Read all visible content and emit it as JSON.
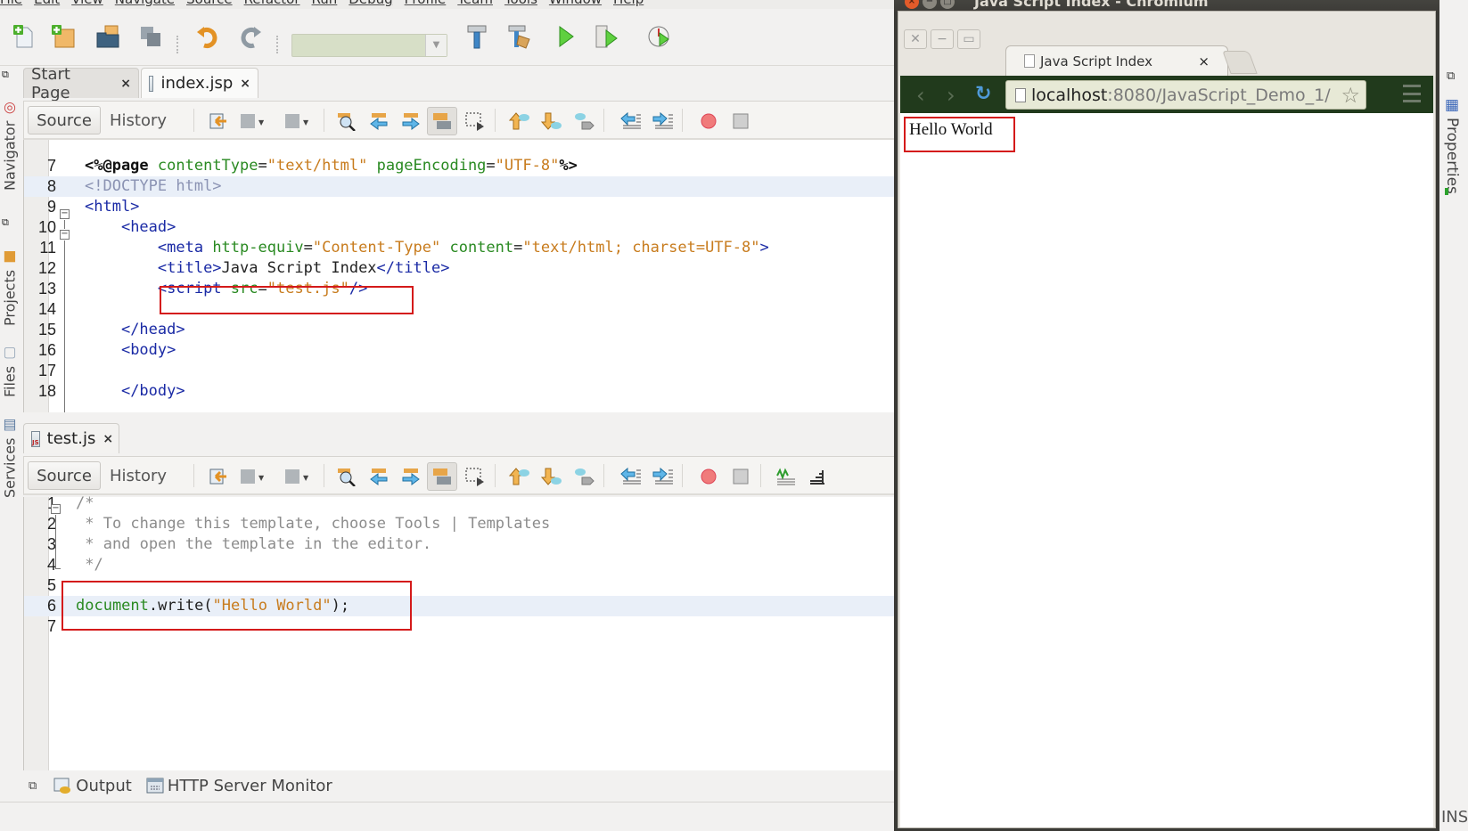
{
  "ide": {
    "menu": [
      "File",
      "Edit",
      "View",
      "Navigate",
      "Source",
      "Refactor",
      "Run",
      "Debug",
      "Profile",
      "Team",
      "Tools",
      "Window",
      "Help"
    ],
    "toolbar": {
      "icons": [
        "new-file-icon",
        "new-project-icon",
        "open-project-icon",
        "save-all-icon",
        "undo-icon",
        "redo-icon",
        "build-icon",
        "clean-build-icon",
        "run-icon",
        "debug-icon",
        "profile-icon"
      ],
      "config_combo_value": ""
    },
    "left_sidebar": [
      "Navigator",
      "Projects",
      "Files",
      "Services"
    ],
    "right_sidebar": [
      "Properties"
    ],
    "top_editor": {
      "tabs": [
        {
          "label": "Start Page",
          "active": false
        },
        {
          "label": "index.jsp",
          "active": true
        }
      ],
      "source_label": "Source",
      "history_label": "History",
      "lines": [
        {
          "n": "7",
          "segments": [
            [
              "dir",
              "<%@page"
            ],
            [
              "plain",
              " "
            ],
            [
              "attr",
              "contentType"
            ],
            [
              "plain",
              "="
            ],
            [
              "str",
              "\"text/html\""
            ],
            [
              "plain",
              " "
            ],
            [
              "attr",
              "pageEncoding"
            ],
            [
              "plain",
              "="
            ],
            [
              "str",
              "\"UTF-8\""
            ],
            [
              "dir",
              "%>"
            ]
          ]
        },
        {
          "n": "8",
          "segments": [
            [
              "doct",
              "<!DOCTYPE html>"
            ]
          ],
          "highlight": true
        },
        {
          "n": "9",
          "segments": [
            [
              "tag",
              "<html>"
            ]
          ]
        },
        {
          "n": "10",
          "segments": [
            [
              "plain",
              "    "
            ],
            [
              "tag",
              "<head>"
            ]
          ]
        },
        {
          "n": "11",
          "segments": [
            [
              "plain",
              "        "
            ],
            [
              "tag",
              "<meta "
            ],
            [
              "attr",
              "http-equiv"
            ],
            [
              "plain",
              "="
            ],
            [
              "str",
              "\"Content-Type\""
            ],
            [
              "plain",
              " "
            ],
            [
              "attr",
              "content"
            ],
            [
              "plain",
              "="
            ],
            [
              "str",
              "\"text/html; charset=UTF-8\""
            ],
            [
              "tag",
              ">"
            ]
          ]
        },
        {
          "n": "12",
          "segments": [
            [
              "plain",
              "        "
            ],
            [
              "tag",
              "<title>"
            ],
            [
              "plain",
              "Java Script Index"
            ],
            [
              "tag",
              "</title>"
            ]
          ]
        },
        {
          "n": "13",
          "segments": [
            [
              "plain",
              "        "
            ],
            [
              "tag",
              "<script "
            ],
            [
              "attr",
              "src"
            ],
            [
              "plain",
              "="
            ],
            [
              "str",
              "\"test.js\""
            ],
            [
              "tag",
              "/>"
            ]
          ]
        },
        {
          "n": "14",
          "segments": []
        },
        {
          "n": "15",
          "segments": [
            [
              "plain",
              "    "
            ],
            [
              "tag",
              "</head>"
            ]
          ]
        },
        {
          "n": "16",
          "segments": [
            [
              "plain",
              "    "
            ],
            [
              "tag",
              "<body>"
            ]
          ]
        },
        {
          "n": "17",
          "segments": []
        },
        {
          "n": "18",
          "segments": [
            [
              "plain",
              "    "
            ],
            [
              "tag",
              "</body>"
            ]
          ]
        }
      ]
    },
    "bottom_editor": {
      "tabs": [
        {
          "label": "test.js",
          "active": true
        }
      ],
      "source_label": "Source",
      "history_label": "History",
      "lines": [
        {
          "n": "1",
          "segments": [
            [
              "cmt",
              "/*"
            ]
          ]
        },
        {
          "n": "2",
          "segments": [
            [
              "cmt",
              " * To change this template, choose Tools | Templates"
            ]
          ]
        },
        {
          "n": "3",
          "segments": [
            [
              "cmt",
              " * and open the template in the editor."
            ]
          ]
        },
        {
          "n": "4",
          "segments": [
            [
              "cmt",
              " */"
            ]
          ]
        },
        {
          "n": "5",
          "segments": []
        },
        {
          "n": "6",
          "segments": [
            [
              "fn",
              "document"
            ],
            [
              "plain",
              ".write("
            ],
            [
              "str",
              "\"Hello World\""
            ],
            [
              "plain",
              ");"
            ]
          ],
          "highlight": true
        },
        {
          "n": "7",
          "segments": []
        }
      ]
    },
    "bottom_panel": {
      "output_label": "Output",
      "http_monitor_label": "HTTP Server Monitor"
    },
    "status": {
      "mode": "INS"
    }
  },
  "browser": {
    "window_title": "Java Script Index - Chromium",
    "tab_title": "Java Script Index",
    "url_host": "localhost",
    "url_rest": ":8080/JavaScript_Demo_1/",
    "page_text": "Hello World"
  },
  "colors": {
    "annotation_red": "#d41a1a",
    "browser_toolbar": "#213a1c",
    "jsp_tag": "#1a2aa5",
    "attr": "#2a8a22",
    "string": "#c87c1e",
    "comment": "#8c8c8c"
  }
}
